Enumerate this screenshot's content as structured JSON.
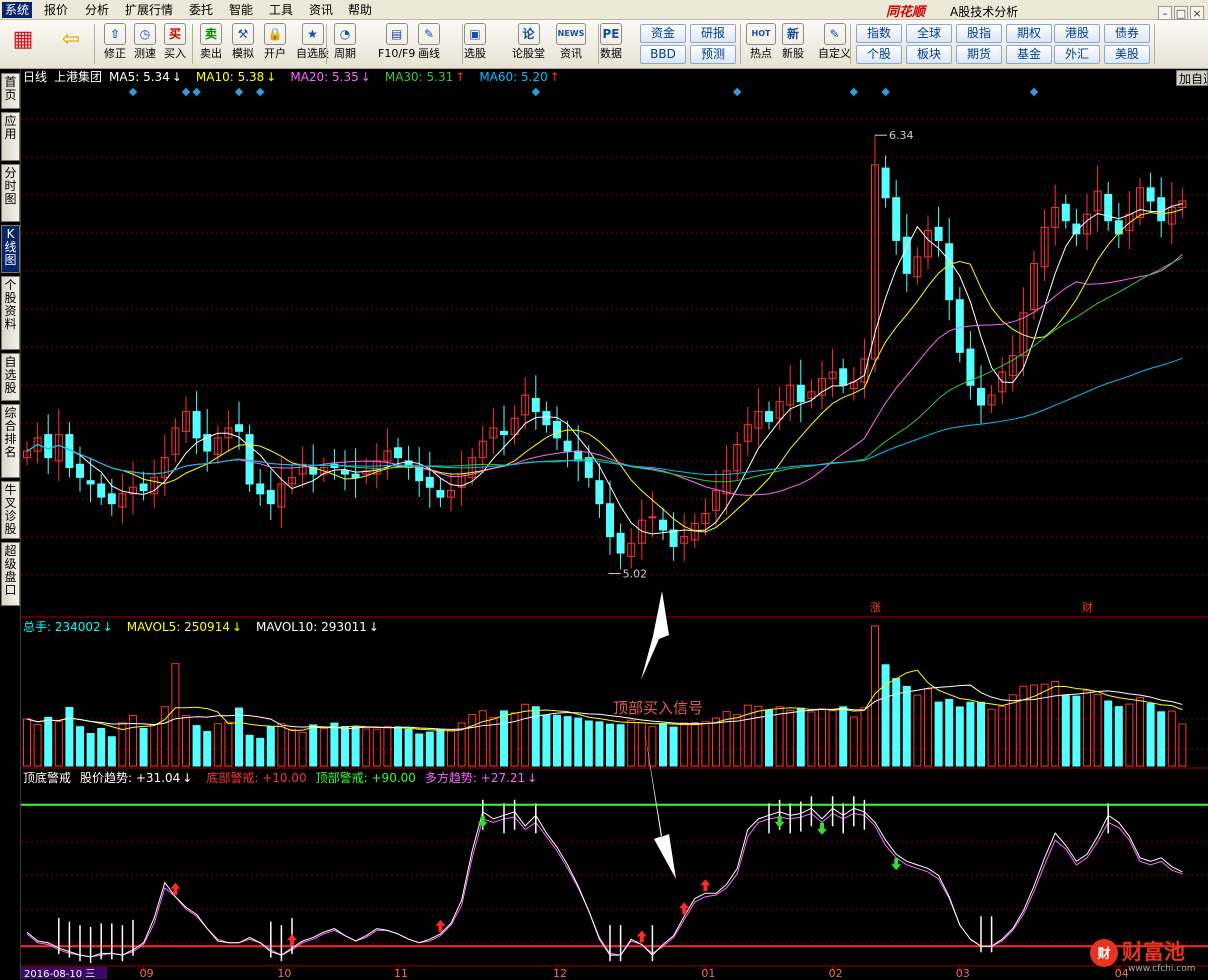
{
  "menu": [
    "系统",
    "报价",
    "分析",
    "扩展行情",
    "委托",
    "智能",
    "工具",
    "资讯",
    "帮助"
  ],
  "brand": "同花顺",
  "app_title": "A股技术分析",
  "toolbar": {
    "buttons": [
      {
        "label": "修正",
        "icon": "refresh-icon",
        "glyph": "⇧"
      },
      {
        "label": "测速",
        "icon": "clock-icon",
        "glyph": "◷"
      },
      {
        "label": "买入",
        "icon": "buy-icon",
        "glyph": "买"
      },
      {
        "label": "卖出",
        "icon": "sell-icon",
        "glyph": "卖"
      },
      {
        "label": "模拟",
        "icon": "hammer-icon",
        "glyph": "⚒"
      },
      {
        "label": "开户",
        "icon": "lock-icon",
        "glyph": "🔒"
      },
      {
        "label": "自选股",
        "icon": "star-icon",
        "glyph": "★"
      },
      {
        "label": "周期",
        "icon": "clock-cycle-icon",
        "glyph": "◔"
      },
      {
        "label": "F10/F9",
        "icon": "f10-icon",
        "glyph": "▤"
      },
      {
        "label": "画线",
        "icon": "pencil-icon",
        "glyph": "✎"
      },
      {
        "label": "选股",
        "icon": "monitor-icon",
        "glyph": "▣"
      },
      {
        "label": "论股堂",
        "icon": "lungutang-icon",
        "glyph": "论"
      },
      {
        "label": "资讯",
        "icon": "news-icon",
        "glyph": "NEWS"
      },
      {
        "label": "数据",
        "icon": "pe-icon",
        "glyph": "PE"
      },
      {
        "label": "热点",
        "icon": "hot-icon",
        "glyph": "HOT"
      },
      {
        "label": "新股",
        "icon": "newstock-icon",
        "glyph": "新"
      },
      {
        "label": "自定义",
        "icon": "custom-icon",
        "glyph": "✎"
      }
    ],
    "quick_buttons": [
      "资金",
      "研报",
      "BBD",
      "预测",
      "指数",
      "全球",
      "股指",
      "期权",
      "港股",
      "债券",
      "个股",
      "板块",
      "期货",
      "基金",
      "外汇",
      "美股"
    ]
  },
  "sidebar": [
    "首页",
    "应用",
    "分时图",
    "K线图",
    "个股资料",
    "自选股",
    "综合排名",
    "牛叉诊股",
    "超级盘口"
  ],
  "stock": {
    "period": "日线",
    "name": "上港集团"
  },
  "ma_legend": [
    {
      "label": "MA5: 5.34",
      "arrow": "↓",
      "color": "#ffffff"
    },
    {
      "label": "MA10: 5.38",
      "arrow": "↓",
      "color": "#ffff00"
    },
    {
      "label": "MA20: 5.35",
      "arrow": "↓",
      "color": "#ff66ff"
    },
    {
      "label": "MA30: 5.31",
      "arrow": "↑",
      "color": "#33cc33"
    },
    {
      "label": "MA60: 5.20",
      "arrow": "↑",
      "color": "#00bfff"
    }
  ],
  "add_indicator_label": "加自选",
  "volume_legend": [
    {
      "label": "总手: 234002",
      "arrow": "↓",
      "color": "#00ffff"
    },
    {
      "label": "MAVOL5: 250914",
      "arrow": "↓",
      "color": "#ffff00"
    },
    {
      "label": "MAVOL10: 293011",
      "arrow": "↓",
      "color": "#ffffff"
    }
  ],
  "indicator_legend": [
    {
      "label": "顶底警戒",
      "arrow": "",
      "color": "#ffffff"
    },
    {
      "label": "股价趋势: +31.04",
      "arrow": "↓",
      "color": "#ffffff"
    },
    {
      "label": "底部警戒: +10.00",
      "arrow": "",
      "color": "#ff3333"
    },
    {
      "label": "顶部警戒: +90.00",
      "arrow": "",
      "color": "#33ff33"
    },
    {
      "label": "多方趋势: +27.21",
      "arrow": "↓",
      "color": "#ff66ff"
    }
  ],
  "annotation": "顶部买入信号",
  "event_markers": [
    "涨",
    "财"
  ],
  "current_date": "2016-08-10 三",
  "watermark": {
    "name": "财富池",
    "url": "www.cfchi.com"
  },
  "colors": {
    "up": "#ff3232",
    "down": "#54ffff",
    "ma5": "#ffffff",
    "ma10": "#ffff00",
    "ma20": "#ff66ff",
    "ma30": "#33cc33",
    "ma60": "#00bfff",
    "grid": "#800000",
    "axis": "#a00000"
  },
  "chart_data": [
    {
      "type": "candlestick",
      "title": "日线 上港集团",
      "x_tick_labels": [
        "09",
        "10",
        "11",
        "12",
        "01",
        "02",
        "03",
        "04"
      ],
      "price_range": [
        4.9,
        6.45
      ],
      "annotations": {
        "low": 5.02,
        "high": 6.34
      },
      "ma_last": {
        "MA5": 5.34,
        "MA10": 5.38,
        "MA20": 5.35,
        "MA30": 5.31,
        "MA60": 5.2
      },
      "close": [
        5.38,
        5.42,
        5.36,
        5.43,
        5.33,
        5.3,
        5.28,
        5.24,
        5.22,
        5.25,
        5.27,
        5.26,
        5.3,
        5.36,
        5.45,
        5.5,
        5.42,
        5.38,
        5.42,
        5.45,
        5.44,
        5.28,
        5.25,
        5.22,
        5.28,
        5.3,
        5.34,
        5.31,
        5.33,
        5.33,
        5.31,
        5.3,
        5.32,
        5.35,
        5.38,
        5.36,
        5.33,
        5.29,
        5.27,
        5.24,
        5.26,
        5.31,
        5.36,
        5.41,
        5.45,
        5.43,
        5.48,
        5.55,
        5.5,
        5.46,
        5.42,
        5.38,
        5.35,
        5.3,
        5.22,
        5.12,
        5.07,
        5.1,
        5.17,
        5.18,
        5.14,
        5.09,
        5.12,
        5.16,
        5.19,
        5.26,
        5.32,
        5.4,
        5.46,
        5.5,
        5.47,
        5.53,
        5.58,
        5.53,
        5.56,
        5.6,
        5.62,
        5.58,
        5.59,
        5.66,
        6.25,
        6.15,
        6.02,
        5.92,
        5.97,
        6.05,
        6.02,
        5.84,
        5.68,
        5.58,
        5.52,
        5.55,
        5.62,
        5.67,
        5.8,
        5.95,
        6.06,
        6.12,
        6.08,
        6.04,
        6.1,
        6.17,
        6.08,
        6.04,
        6.1,
        6.18,
        6.14,
        6.08,
        6.12,
        6.14
      ],
      "volume_unit": "手",
      "volume_last": 234002,
      "volume": [
        262000,
        231000,
        271000,
        247000,
        326000,
        219000,
        181000,
        209000,
        163000,
        241000,
        281000,
        209000,
        232000,
        330000,
        570000,
        281000,
        225000,
        192000,
        236000,
        244000,
        323000,
        171000,
        154000,
        218000,
        236000,
        204000,
        188000,
        229000,
        210000,
        239000,
        220000,
        217000,
        206000,
        205000,
        220000,
        218000,
        204000,
        178000,
        189000,
        202000,
        201000,
        240000,
        286000,
        308000,
        269000,
        307000,
        296000,
        344000,
        330000,
        284000,
        282000,
        275000,
        267000,
        251000,
        246000,
        233000,
        230000,
        255000,
        240000,
        219000,
        236000,
        217000,
        240000,
        242000,
        247000,
        267000,
        303000,
        286000,
        339000,
        333000,
        312000,
        330000,
        310000,
        322000,
        301000,
        318000,
        308000,
        330000,
        273000,
        325000,
        780000,
        564000,
        487000,
        443000,
        395000,
        429000,
        356000,
        371000,
        329000,
        355000,
        355000,
        316000,
        332000,
        397000,
        444000,
        451000,
        456000,
        471000,
        393000,
        389000,
        421000,
        399000,
        362000,
        331000,
        345000,
        381000,
        348000,
        302000,
        306000,
        234002
      ]
    },
    {
      "type": "line",
      "title": "顶底警戒",
      "ylim": [
        0,
        100
      ],
      "series": [
        {
          "name": "股价趋势",
          "values": [
            18,
            13,
            12,
            9,
            7,
            5,
            4,
            6,
            6,
            5,
            8,
            12,
            26,
            46,
            38,
            32,
            28,
            20,
            13,
            12,
            12,
            15,
            12,
            7,
            5,
            9,
            13,
            15,
            18,
            20,
            16,
            13,
            16,
            20,
            19,
            17,
            14,
            12,
            14,
            17,
            23,
            36,
            64,
            86,
            82,
            84,
            86,
            78,
            84,
            74,
            66,
            56,
            44,
            30,
            14,
            5,
            5,
            14,
            11,
            5,
            11,
            16,
            27,
            37,
            40,
            40,
            45,
            54,
            76,
            82,
            84,
            86,
            84,
            85,
            88,
            82,
            88,
            84,
            88,
            86,
            80,
            70,
            62,
            58,
            56,
            54,
            50,
            38,
            22,
            14,
            10,
            10,
            14,
            20,
            30,
            44,
            60,
            74,
            67,
            58,
            62,
            72,
            84,
            80,
            72,
            60,
            58,
            60,
            55,
            52
          ]
        },
        {
          "name": "多方趋势",
          "values": [
            17,
            12,
            11,
            8,
            6,
            5,
            4,
            5,
            6,
            5,
            7,
            11,
            23,
            43,
            38,
            31,
            27,
            20,
            14,
            12,
            12,
            14,
            12,
            8,
            5,
            8,
            12,
            14,
            17,
            19,
            16,
            13,
            15,
            19,
            19,
            17,
            14,
            12,
            13,
            16,
            22,
            33,
            60,
            82,
            80,
            82,
            83,
            76,
            80,
            72,
            64,
            54,
            43,
            30,
            15,
            6,
            5,
            13,
            11,
            6,
            10,
            15,
            25,
            35,
            38,
            39,
            43,
            51,
            72,
            80,
            82,
            83,
            82,
            83,
            85,
            80,
            85,
            82,
            85,
            84,
            78,
            67,
            60,
            56,
            54,
            52,
            48,
            37,
            22,
            14,
            10,
            10,
            13,
            19,
            28,
            41,
            56,
            70,
            65,
            56,
            60,
            69,
            80,
            77,
            70,
            58,
            56,
            58,
            53,
            51
          ]
        },
        {
          "name": "底部警戒",
          "values": [
            10
          ]
        },
        {
          "name": "顶部警戒",
          "values": [
            90
          ]
        }
      ]
    }
  ]
}
